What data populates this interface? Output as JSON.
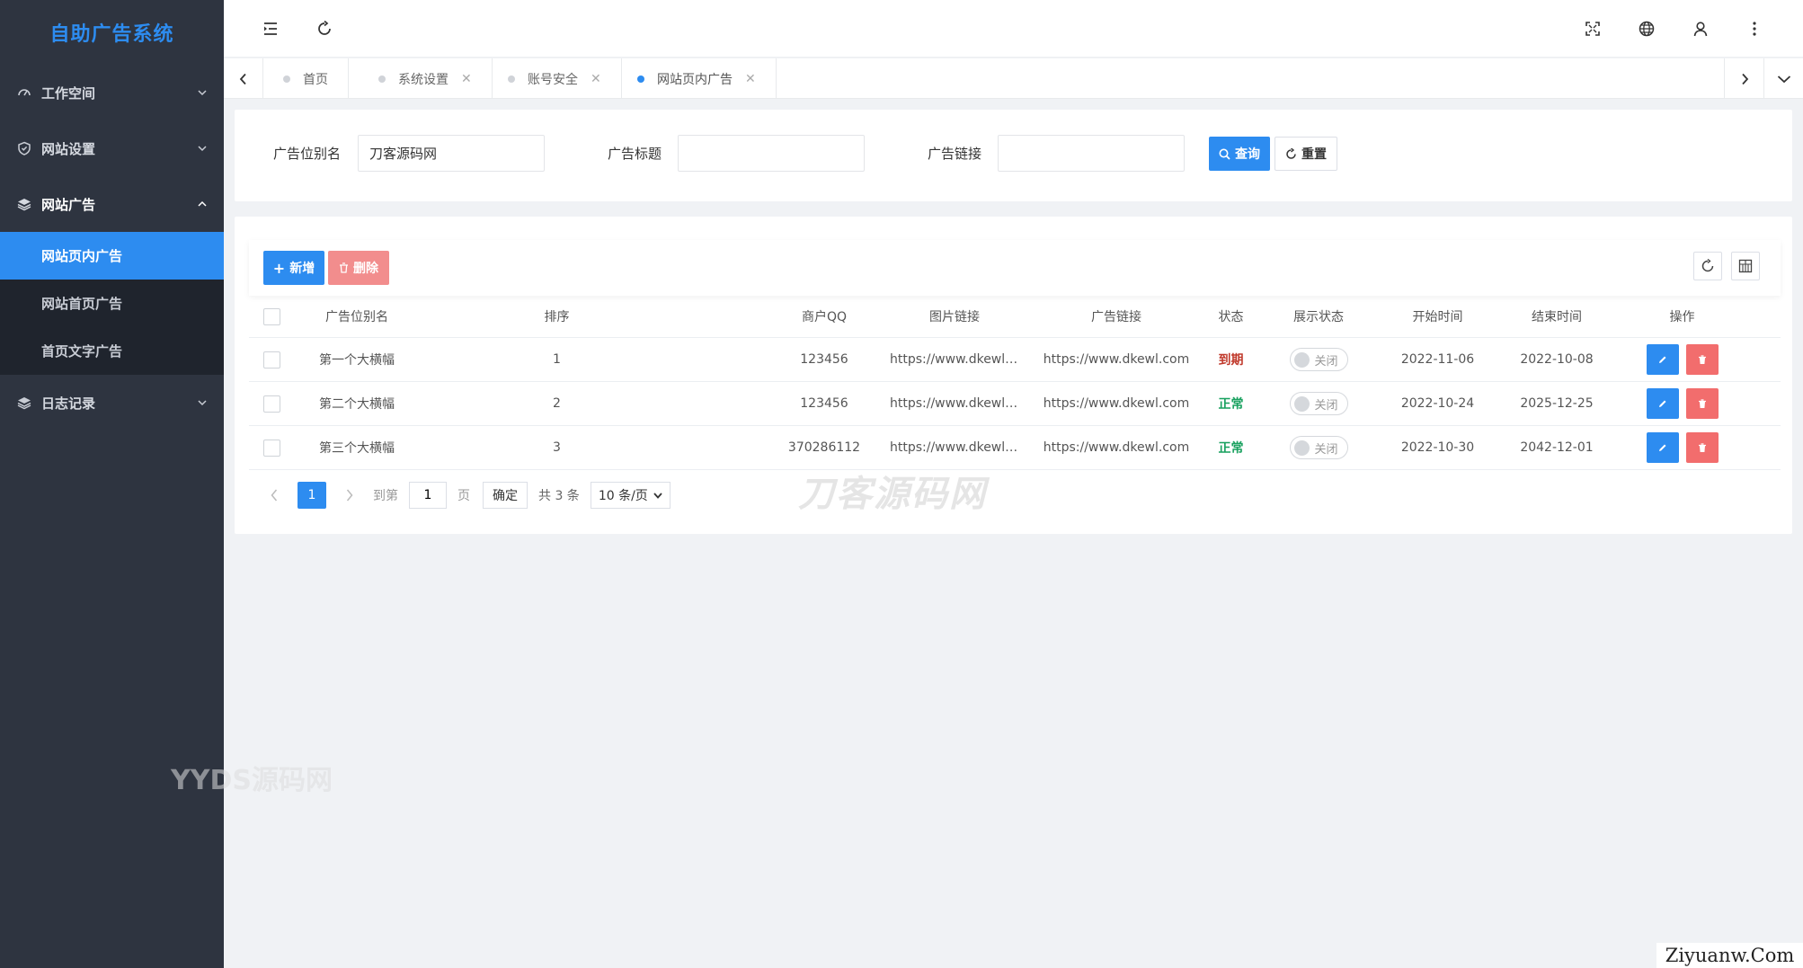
{
  "sidebar": {
    "brand": "自助广告系统",
    "groups": [
      {
        "label": "工作空间",
        "icon": "dashboard-icon"
      },
      {
        "label": "网站设置",
        "icon": "shield-icon"
      },
      {
        "label": "网站广告",
        "icon": "layers-icon"
      },
      {
        "label": "日志记录",
        "icon": "layers-icon"
      }
    ],
    "sub_items": [
      "网站页内广告",
      "网站首页广告",
      "首页文字广告"
    ]
  },
  "tabs": [
    {
      "label": "首页"
    },
    {
      "label": "系统设置"
    },
    {
      "label": "账号安全"
    },
    {
      "label": "网站页内广告"
    }
  ],
  "search": {
    "label_name": "广告位别名",
    "value_name": "刀客源码网",
    "label_title": "广告标题",
    "value_title": "",
    "label_link": "广告链接",
    "value_link": "",
    "query_btn": "查询",
    "reset_btn": "重置"
  },
  "toolbar": {
    "add_btn": "新增",
    "delete_btn": "删除"
  },
  "table": {
    "headers": [
      "广告位别名",
      "排序",
      "商户QQ",
      "图片链接",
      "广告链接",
      "状态",
      "展示状态",
      "开始时间",
      "结束时间",
      "操作"
    ],
    "rows": [
      {
        "name": "第一个大横幅",
        "sort": "1",
        "qq": "123456",
        "img": "https://www.dkewl.com",
        "link": "https://www.dkewl.com",
        "status": "到期",
        "show": "关闭",
        "start": "2022-11-06",
        "end": "2022-10-08"
      },
      {
        "name": "第二个大横幅",
        "sort": "2",
        "qq": "123456",
        "img": "https://www.dkewl.com",
        "link": "https://www.dkewl.com",
        "status": "正常",
        "show": "关闭",
        "start": "2022-10-24",
        "end": "2025-12-25"
      },
      {
        "name": "第三个大横幅",
        "sort": "3",
        "qq": "370286112",
        "img": "https://www.dkewl.com",
        "link": "https://www.dkewl.com",
        "status": "正常",
        "show": "关闭",
        "start": "2022-10-30",
        "end": "2042-12-01"
      }
    ]
  },
  "pager": {
    "current": "1",
    "goto_label": "到第",
    "goto_value": "1",
    "page_unit": "页",
    "confirm": "确定",
    "total": "共 3 条",
    "page_size": "10 条/页"
  },
  "watermarks": {
    "center": "刀客源码网",
    "left": "YYDS源码网",
    "corner": "Ziyuanw.Com"
  },
  "colors": {
    "primary": "#2d8cf0",
    "sidebar_bg": "#2e3440",
    "danger": "#f26d6d",
    "expired": "#c0392b",
    "normal": "#19a15f"
  }
}
